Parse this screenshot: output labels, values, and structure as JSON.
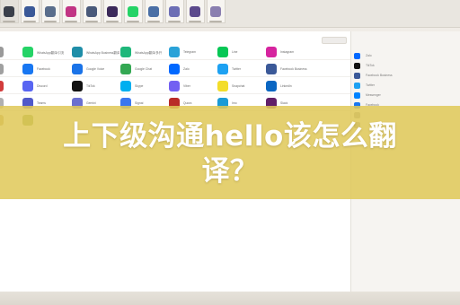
{
  "headline": {
    "line1": "上下级沟通hello该怎么翻",
    "line2": "译？"
  },
  "tab_icon_colors": [
    "#3a3f4a",
    "#3b5998",
    "#5a6e8c",
    "#c13584",
    "#4a5a7a",
    "#3c2a5a",
    "#25d366",
    "#4a6fa5",
    "#6d6fb5",
    "#5c4a8c",
    "#8a7fb0"
  ],
  "search": {
    "placeholder": ""
  },
  "main_grid": [
    {
      "label": "",
      "color": "#9a9a9a"
    },
    {
      "label": "WhatsApp翻译/引流",
      "color": "#25d366"
    },
    {
      "label": "WhatsApp Business翻译",
      "color": "#1f8ea8"
    },
    {
      "label": "WhatsApp翻译/多开",
      "color": "#1fb77a"
    },
    {
      "label": "Telegram",
      "color": "#2aa2d8"
    },
    {
      "label": "Line",
      "color": "#06c755"
    },
    {
      "label": "Instagram",
      "color": "#d6249f"
    },
    {
      "label": "",
      "color": "#a0a0a0"
    },
    {
      "label": "Facebook",
      "color": "#1877f2"
    },
    {
      "label": "Google Voice",
      "color": "#1a73e8"
    },
    {
      "label": "Google Chat",
      "color": "#34a853"
    },
    {
      "label": "Zalo",
      "color": "#0068ff"
    },
    {
      "label": "Twitter",
      "color": "#1da1f2"
    },
    {
      "label": "Facebook Business",
      "color": "#3b5998"
    },
    {
      "label": "",
      "color": "#d23c3c"
    },
    {
      "label": "Discord",
      "color": "#5865f2"
    },
    {
      "label": "TikTok",
      "color": "#111111"
    },
    {
      "label": "Skype",
      "color": "#00aff0"
    },
    {
      "label": "Viber",
      "color": "#7360f2"
    },
    {
      "label": "Snapchat",
      "color": "#f3dd2a"
    },
    {
      "label": "LinkedIn",
      "color": "#0a66c2"
    },
    {
      "label": "",
      "color": "#b0b0b0"
    },
    {
      "label": "Teams",
      "color": "#5059c9"
    },
    {
      "label": "Gemini",
      "color": "#6a6fd0"
    },
    {
      "label": "Signal",
      "color": "#3a76f0"
    },
    {
      "label": "Quora",
      "color": "#b92b27"
    },
    {
      "label": "Imo",
      "color": "#1a9bd7"
    },
    {
      "label": "Slack",
      "color": "#611f69"
    },
    {
      "label": "",
      "color": "#c0a060"
    },
    {
      "label": "",
      "color": "#8aa040"
    }
  ],
  "sidebar": {
    "title": "",
    "items": [
      {
        "label": "Zalo",
        "color": "#0068ff"
      },
      {
        "label": "TikTok",
        "color": "#111111"
      },
      {
        "label": "Facebook Business",
        "color": "#3b5998"
      },
      {
        "label": "Twitter",
        "color": "#1da1f2"
      },
      {
        "label": "Messenger",
        "color": "#0084ff"
      },
      {
        "label": "Facebook",
        "color": "#1877f2"
      },
      {
        "label": "",
        "color": "#999999"
      },
      {
        "label": "",
        "color": "#999999"
      }
    ]
  }
}
